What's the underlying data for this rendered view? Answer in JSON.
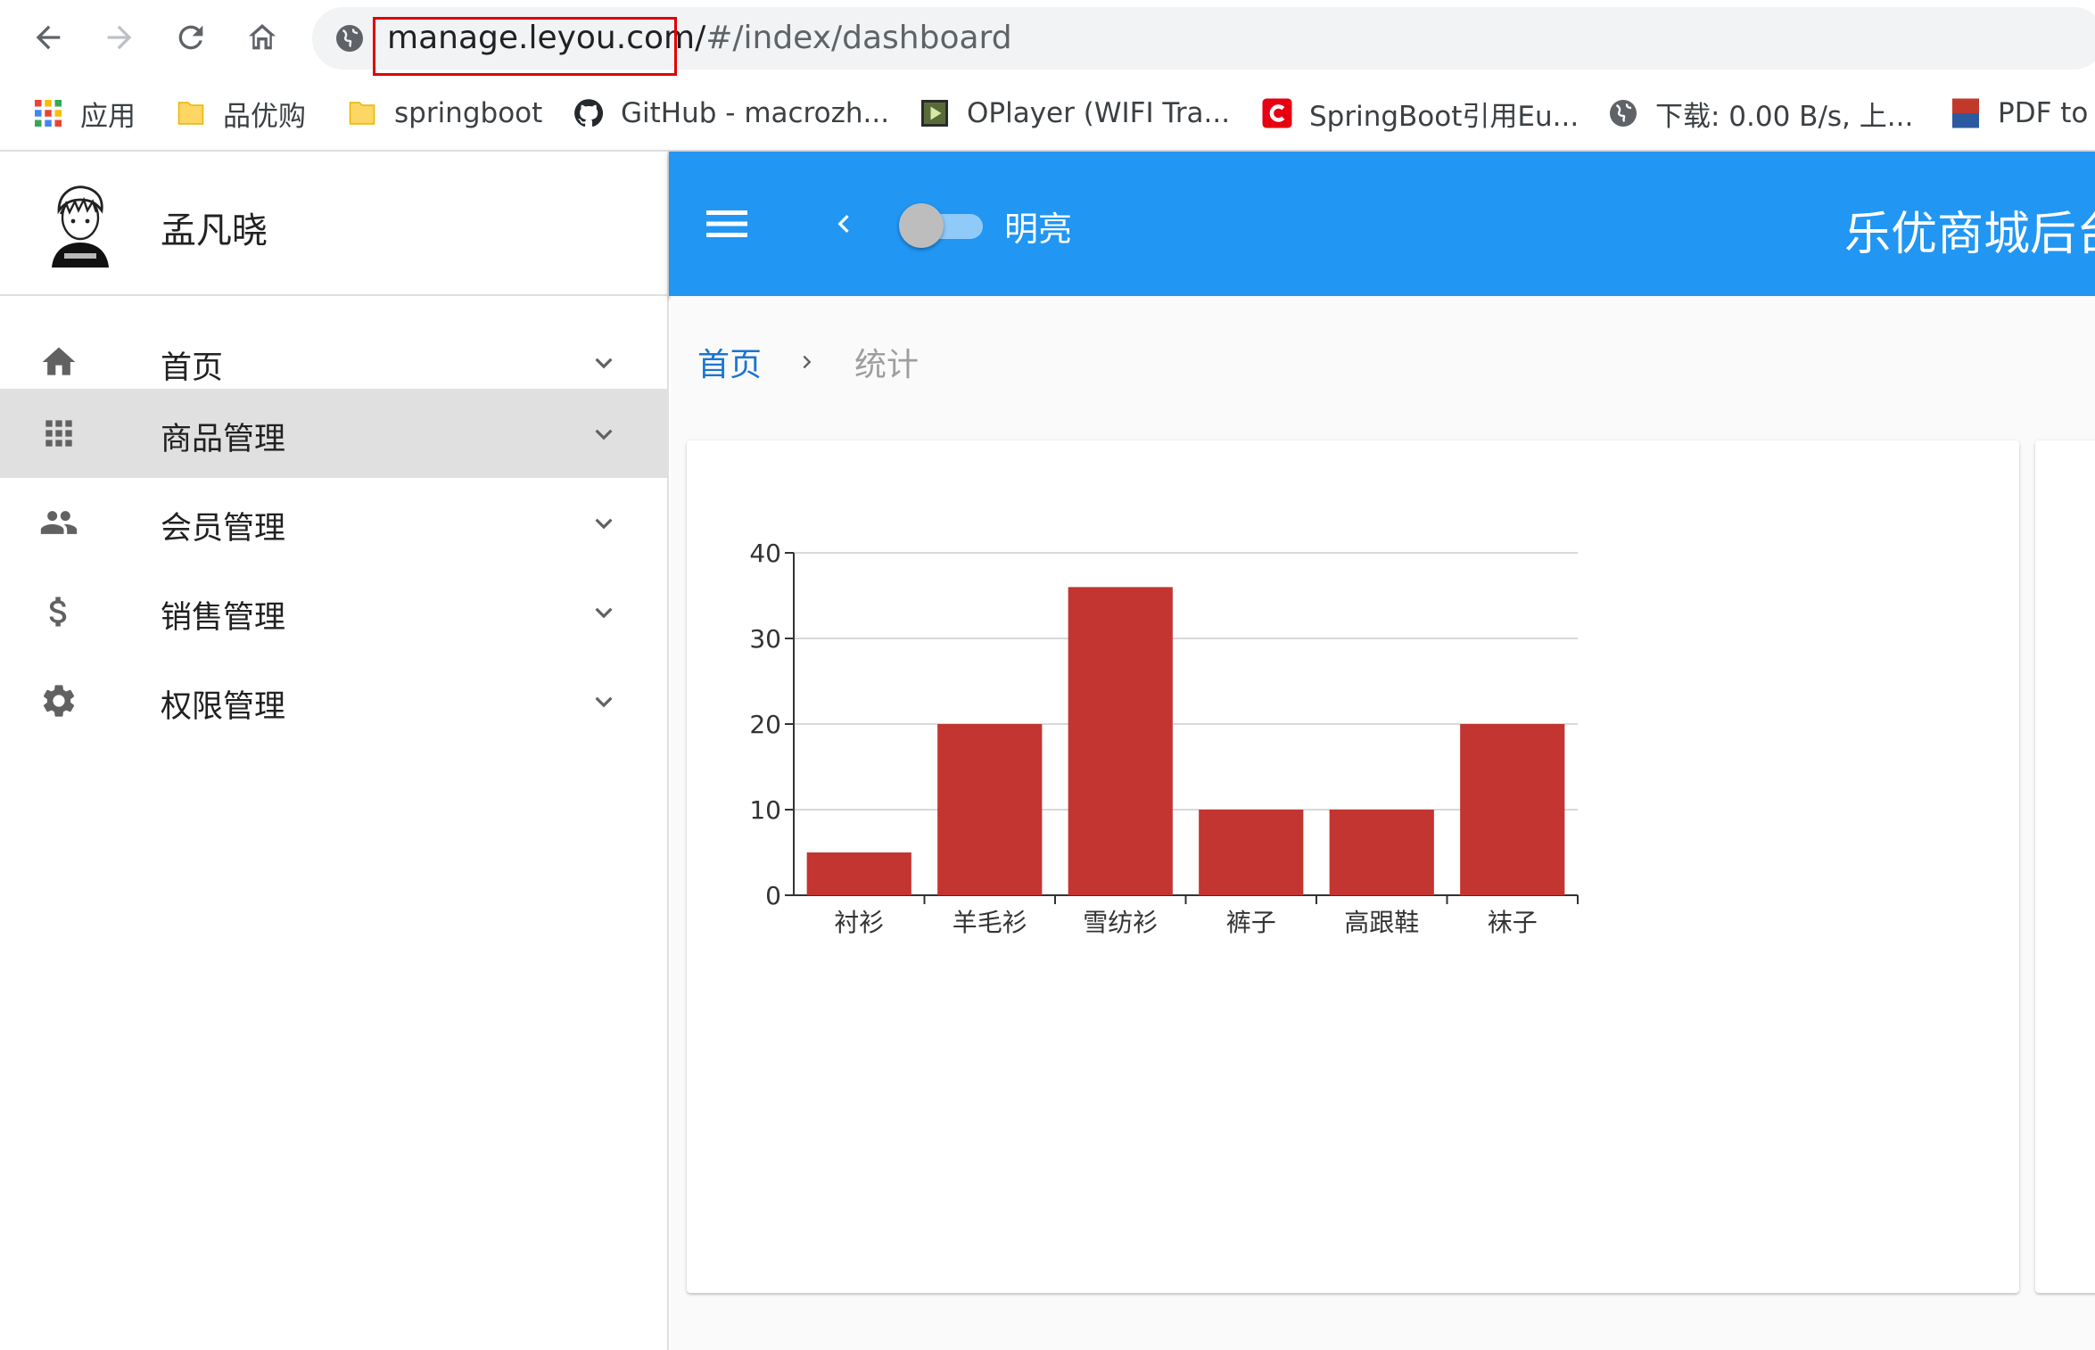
{
  "browser": {
    "url_host": "manage.leyou.com/",
    "url_path": "#/index/dashboard",
    "bookmarks": [
      {
        "label": "应用",
        "icon": "apps-grid-icon"
      },
      {
        "label": "品优购",
        "icon": "folder-icon"
      },
      {
        "label": "springboot",
        "icon": "folder-icon"
      },
      {
        "label": "GitHub - macrozh...",
        "icon": "github-icon"
      },
      {
        "label": "OPlayer (WIFI Tra...",
        "icon": "oplayer-icon"
      },
      {
        "label": "SpringBoot引用Eu...",
        "icon": "csdn-icon"
      },
      {
        "label": "下载: 0.00 B/s, 上...",
        "icon": "globe-icon"
      },
      {
        "label": "PDF to",
        "icon": "pdf-icon"
      }
    ]
  },
  "sidebar": {
    "user_name": "孟凡晓",
    "items": [
      {
        "label": "首页",
        "icon": "home-icon"
      },
      {
        "label": "商品管理",
        "icon": "apps-icon"
      },
      {
        "label": "会员管理",
        "icon": "people-icon"
      },
      {
        "label": "销售管理",
        "icon": "dollar-icon"
      },
      {
        "label": "权限管理",
        "icon": "settings-icon"
      }
    ],
    "active_index": 1
  },
  "appbar": {
    "switch_label": "明亮",
    "title": "乐优商城后台",
    "color": "#2196f3"
  },
  "breadcrumb": {
    "home": "首页",
    "current": "统计"
  },
  "chart_data": {
    "type": "bar",
    "categories": [
      "衬衫",
      "羊毛衫",
      "雪纺衫",
      "裤子",
      "高跟鞋",
      "袜子"
    ],
    "values": [
      5,
      20,
      36,
      10,
      10,
      20
    ],
    "ylim": [
      0,
      40
    ],
    "yticks": [
      0,
      10,
      20,
      30,
      40
    ],
    "grid": true,
    "bar_color": "#c23531"
  }
}
